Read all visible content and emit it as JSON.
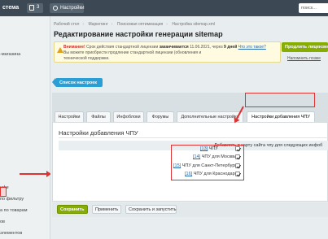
{
  "topbar": {
    "brand": "стема",
    "badge_count": "3",
    "settings_label": "Настройки",
    "search_placeholder": "поиск..."
  },
  "sidebar": {
    "items": [
      "-магазина",
      "ифе",
      "по фильтру",
      "а по товарам",
      "ов",
      "элементов"
    ]
  },
  "breadcrumbs": [
    "Рабочий стол",
    "Маркетинг",
    "Поисковая оптимизация",
    "Настройка sitemap.xml"
  ],
  "page_title": "Редактирование настройки генерации sitemap",
  "alert": {
    "lead": "Внимание!",
    "text1": " Срок действия стандартной лицензии ",
    "text_bold": "заканчивается",
    "text2": " 11.06.2021, через ",
    "days": "9 дней",
    "link": "Что это такое?",
    "text3": "Вы можете приобрести продление стандартной лицензии (обновления и",
    "text4": "технической поддержки."
  },
  "license_button": "Продлить лицензию",
  "hide_link": "Напомнить позже",
  "list_button": "Список настроек",
  "tabs": [
    "Настройки",
    "Файлы",
    "Инфоблоки",
    "Форумы",
    "Дополнительные настройки",
    "Настройки добавления ЧПУ"
  ],
  "panel": {
    "heading": "Настройки добавления ЧПУ",
    "subheading": "Добавлять в карту сайта чпу для следующих инфоб"
  },
  "checkboxes": [
    {
      "id": "[13]",
      "label": "ЧПУ",
      "checked": true
    },
    {
      "id": "[14]",
      "label": "ЧПУ для Москвы",
      "checked": true
    },
    {
      "id": "[15]",
      "label": "ЧПУ для Санкт-Петербурга",
      "checked": true
    },
    {
      "id": "[16]",
      "label": "ЧПУ для Краснодара",
      "checked": true
    }
  ],
  "buttons": {
    "save": "Сохранить",
    "apply": "Применить",
    "save_run": "Сохранить и запустить"
  }
}
